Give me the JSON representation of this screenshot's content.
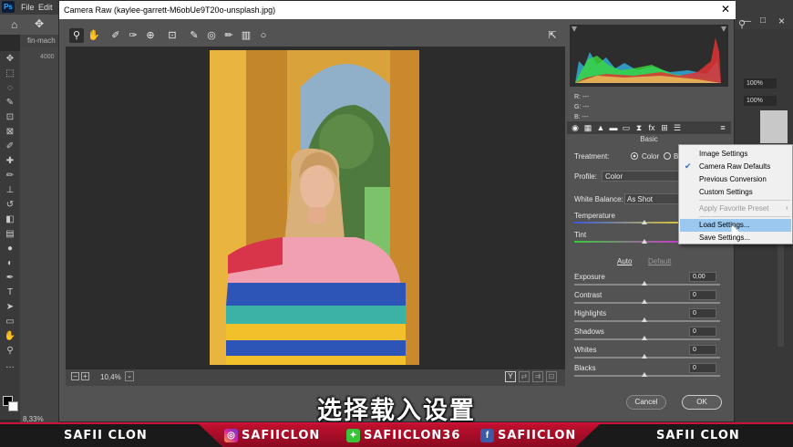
{
  "ps": {
    "menu": [
      "File",
      "Edit"
    ],
    "logo": "Ps",
    "doc_tab": "fin-mach",
    "ruler_top": "4000",
    "zoom_status": "8,33%",
    "right_panel": {
      "zoom1": "100%",
      "zoom2": "100%"
    }
  },
  "dialog": {
    "title": "Camera Raw (kaylee-garrett-M6obUe9T20o-unsplash.jpg)",
    "zoom_level": "10,4%",
    "rgb": {
      "r": "R:  ---",
      "g": "G:  ---",
      "b": "B:  ---"
    },
    "panel_title": "Basic",
    "treatment_label": "Treatment:",
    "treatment_color": "Color",
    "treatment_bw": "Bl",
    "profile_label": "Profile:",
    "profile_value": "Color",
    "wb_label": "White Balance:",
    "wb_value": "As Shot",
    "temperature_label": "Temperature",
    "tint_label": "Tint",
    "auto_label": "Auto",
    "default_label": "Default",
    "sliders": [
      {
        "label": "Exposure",
        "value": "0,00"
      },
      {
        "label": "Contrast",
        "value": "0"
      },
      {
        "label": "Highlights",
        "value": "0"
      },
      {
        "label": "Shadows",
        "value": "0"
      },
      {
        "label": "Whites",
        "value": "0"
      },
      {
        "label": "Blacks",
        "value": "0"
      }
    ],
    "cancel_label": "Cancel",
    "ok_label": "OK"
  },
  "menu": {
    "items": [
      {
        "label": "Image Settings",
        "state": "normal"
      },
      {
        "label": "Camera Raw Defaults",
        "state": "checked"
      },
      {
        "label": "Previous Conversion",
        "state": "normal"
      },
      {
        "label": "Custom Settings",
        "state": "normal"
      },
      {
        "label": "Apply Favorite Preset",
        "state": "disabled"
      },
      {
        "label": "Load Settings...",
        "state": "hover"
      },
      {
        "label": "Save Settings...",
        "state": "normal"
      }
    ]
  },
  "subtitle": "选择载入设置",
  "banner": {
    "left_name": "SAFII CLON",
    "instagram": "SAFIICLON",
    "other": "SAFIICLON36",
    "facebook": "SAFIICLON",
    "right_name": "SAFII CLON",
    "accent": "#c0102e"
  },
  "icons": {
    "zoom": "zoom-tool-icon",
    "hand": "hand-tool-icon",
    "close": "close-icon"
  }
}
